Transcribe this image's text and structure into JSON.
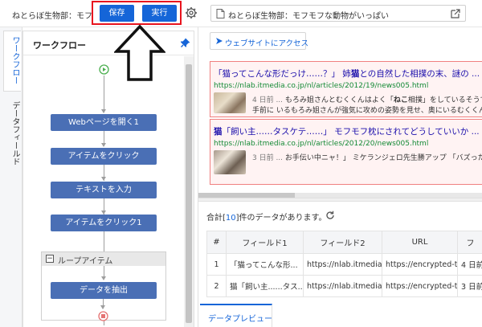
{
  "app": {
    "title": "ねとらぼ生物部：モフ...",
    "save_label": "保存",
    "run_label": "実行",
    "url_text": "ねとらぼ生物部：モフモフな動物がいっぱい"
  },
  "vtabs": [
    {
      "label": "ワークフロー",
      "active": true
    },
    {
      "label": "データフィールド",
      "active": false
    }
  ],
  "workflow": {
    "title": "ワークフロー",
    "steps": [
      "Webページを開く1",
      "アイテムをクリック",
      "テキストを入力",
      "アイテムをクリック1"
    ],
    "loop_label": "ループアイテム",
    "loop_step": "データを抽出"
  },
  "browser": {
    "visit_label": "ウェブサイトにアクセス",
    "results": [
      {
        "title_prefix": "「猫ってこんな形だっけ……？」 姉",
        "title_bold": "猫",
        "title_suffix": "との自然した相撲の末、謎の ...",
        "url": "https://nlab.itmedia.co.jp/nl/articles/2012/19/news005.html",
        "snippet1_gray": "4 日前 ...",
        "snippet1_pre": " もろみ姐さんとむくくんはよく「",
        "snippet1_bold": "ねこ",
        "snippet1_post": "相撲」をしているそうですが",
        "snippet2": "手前に いるもろみ姐さんが強気に攻めの姿勢を見せ、奥にいるむくくんが"
      },
      {
        "title_bold": "猫",
        "title_suffix": "「飼い主……タスケテ……」 モフモフ枕にされてどうしていいか ...",
        "url": "https://nlab.itmedia.co.jp/nl/articles/2012/20/news005.html",
        "snippet1_gray": "3 日前 ...",
        "snippet1_pre": " お手伝い中ニャ！」 ミケランジェロ先生勝アップ 「バズった？",
        "snippet1_bold": "",
        "snippet1_post": "",
        "snippet2": ""
      }
    ]
  },
  "data_panel": {
    "summary_pre": "合計[",
    "summary_count": "10",
    "summary_post": "]件のデータがあります。",
    "columns": [
      "#",
      "フィールド1",
      "フィールド2",
      "URL",
      "フ"
    ],
    "rows": [
      [
        "1",
        "「猫ってこんな形...",
        "https://nlab.itmedia...",
        "https://encrypted-t...",
        "4 日前"
      ],
      [
        "2",
        "猫「飼い主......タス...",
        "https://nlab.itmedia...",
        "https://encrypted-t...",
        "3 日前"
      ]
    ],
    "tab_label": "データプレビュー"
  },
  "colors": {
    "accent": "#1565d8",
    "step": "#4a6fb5",
    "highlight": "#e8141e",
    "link": "#1a0dab",
    "url_green": "#138a36"
  }
}
